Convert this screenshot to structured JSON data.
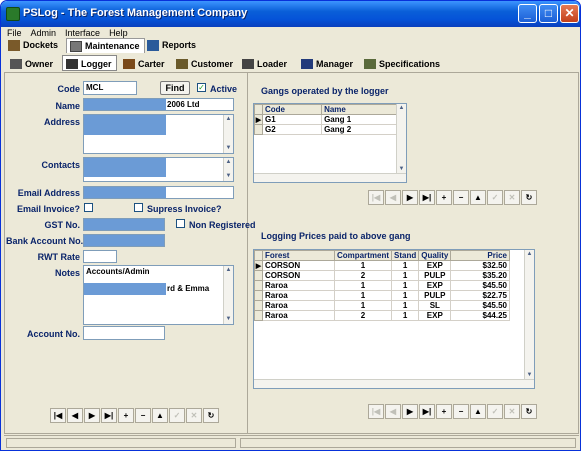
{
  "window": {
    "title": "PSLog - The Forest Management Company"
  },
  "menu": [
    "File",
    "Admin",
    "Interface",
    "Help"
  ],
  "main_tabs": [
    {
      "label": "Dockets"
    },
    {
      "label": "Maintenance"
    },
    {
      "label": "Reports"
    }
  ],
  "sub_tabs": [
    {
      "label": "Owner"
    },
    {
      "label": "Logger"
    },
    {
      "label": "Carter"
    },
    {
      "label": "Customer"
    },
    {
      "label": "Loader"
    },
    {
      "label": "Manager"
    },
    {
      "label": "Specifications"
    }
  ],
  "form": {
    "code_label": "Code",
    "code_value": "MCL",
    "find_label": "Find",
    "active_label": "Active",
    "name_label": "Name",
    "name_suffix": "2006 Ltd",
    "address_label": "Address",
    "contacts_label": "Contacts",
    "email_label": "Email Address",
    "email_invoice_label": "Email Invoice?",
    "supress_label": "Supress Invoice?",
    "gst_label": "GST No.",
    "non_registered_label": "Non Registered",
    "bank_label": "Bank Account No.",
    "rwt_label": "RWT Rate",
    "notes_label": "Notes",
    "notes_line1": "Accounts/Admin",
    "notes_line2": "rd & Emma",
    "account_label": "Account No."
  },
  "gangs": {
    "title": "Gangs operated by the logger",
    "columns": [
      "Code",
      "Name"
    ],
    "rows": [
      [
        "G1",
        "Gang 1"
      ],
      [
        "G2",
        "Gang 2"
      ]
    ]
  },
  "prices": {
    "title": "Logging Prices paid to above gang",
    "columns": [
      "Forest",
      "Compartment",
      "Stand",
      "Quality",
      "Price"
    ],
    "rows": [
      [
        "CORSON",
        "1",
        "1",
        "EXP",
        "$32.50"
      ],
      [
        "CORSON",
        "2",
        "1",
        "PULP",
        "$35.20"
      ],
      [
        "Raroa",
        "1",
        "1",
        "EXP",
        "$45.50"
      ],
      [
        "Raroa",
        "1",
        "1",
        "PULP",
        "$22.75"
      ],
      [
        "Raroa",
        "1",
        "1",
        "SL",
        "$45.50"
      ],
      [
        "Raroa",
        "2",
        "1",
        "EXP",
        "$44.25"
      ]
    ]
  },
  "icons": {
    "nav": [
      "first-icon",
      "prior-icon",
      "next-icon",
      "last-icon",
      "insert-icon",
      "delete-icon",
      "edit-icon",
      "post-icon",
      "cancel-icon",
      "refresh-icon"
    ]
  }
}
